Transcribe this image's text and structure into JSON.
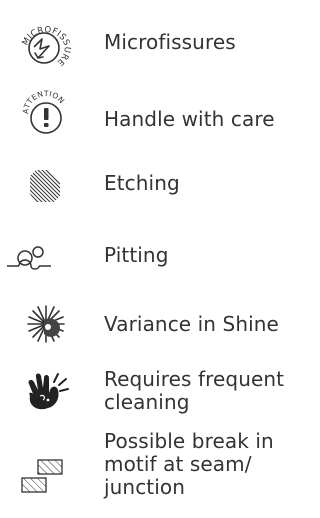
{
  "colors": {
    "text": "#333333",
    "icon": "#333333"
  },
  "legend": {
    "items": [
      {
        "icon": "microfissure-stamp-icon",
        "stamp_text": "MICROFISSURE",
        "label": "Microfissures"
      },
      {
        "icon": "attention-stamp-icon",
        "stamp_text": "ATTENTION",
        "label": "Handle with care"
      },
      {
        "icon": "etching-hatch-icon",
        "label": "Etching"
      },
      {
        "icon": "pitting-icon",
        "label": "Pitting"
      },
      {
        "icon": "shine-variance-icon",
        "label": "Variance in Shine"
      },
      {
        "icon": "handprint-icon",
        "label": "Requires frequent cleaning"
      },
      {
        "icon": "seam-tiles-icon",
        "label": "Possible break in motif at seam/ junction"
      }
    ]
  }
}
